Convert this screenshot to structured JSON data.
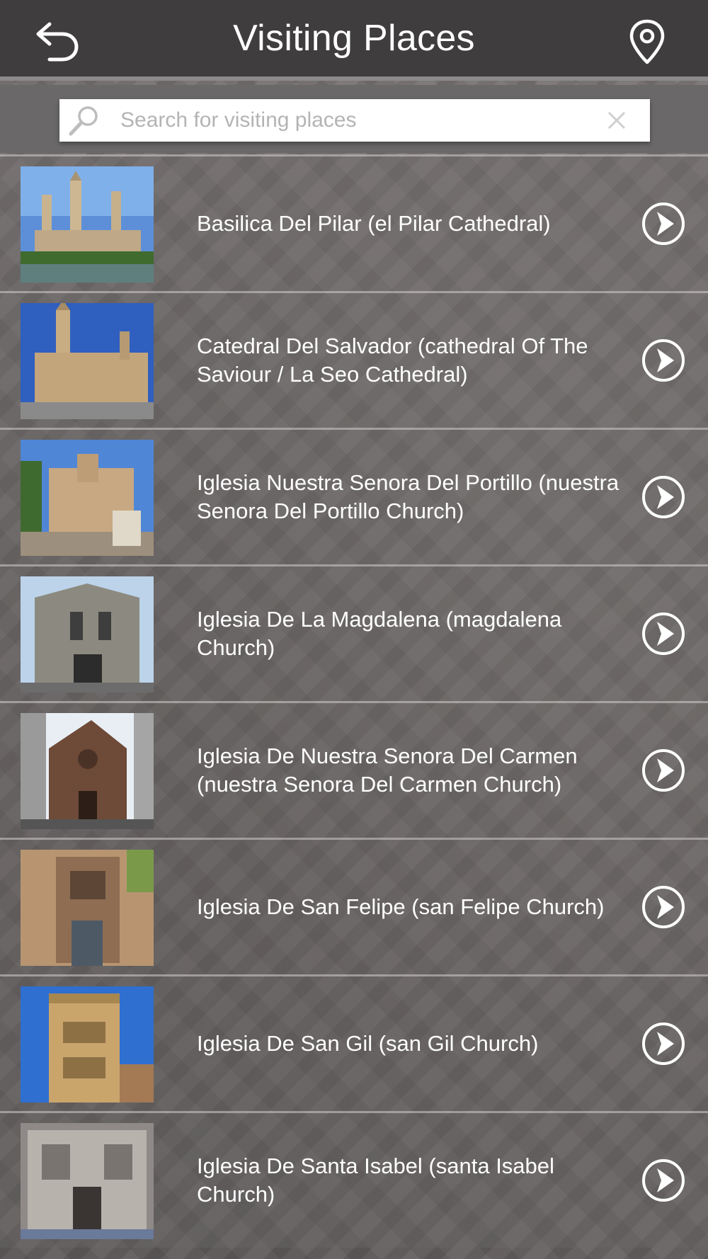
{
  "header": {
    "title": "Visiting Places",
    "back_icon": "back-arrow-icon",
    "location_icon": "map-pin-icon"
  },
  "search": {
    "placeholder": "Search for visiting places",
    "value": ""
  },
  "places": [
    {
      "name": "Basilica Del Pilar (el Pilar Cathedral)"
    },
    {
      "name": "Catedral Del Salvador (cathedral Of The Saviour / La Seo Cathedral)"
    },
    {
      "name": "Iglesia Nuestra Senora Del Portillo (nuestra Senora Del Portillo Church)"
    },
    {
      "name": "Iglesia De La Magdalena (magdalena Church)"
    },
    {
      "name": "Iglesia De Nuestra Senora Del Carmen (nuestra Senora Del Carmen Church)"
    },
    {
      "name": "Iglesia De San Felipe (san Felipe Church)"
    },
    {
      "name": "Iglesia De San Gil (san Gil Church)"
    },
    {
      "name": "Iglesia De Santa Isabel (santa Isabel Church)"
    }
  ],
  "colors": {
    "header_bg": "#3f3d3e",
    "text": "#ffffff",
    "sky": "#3d6fc4"
  }
}
